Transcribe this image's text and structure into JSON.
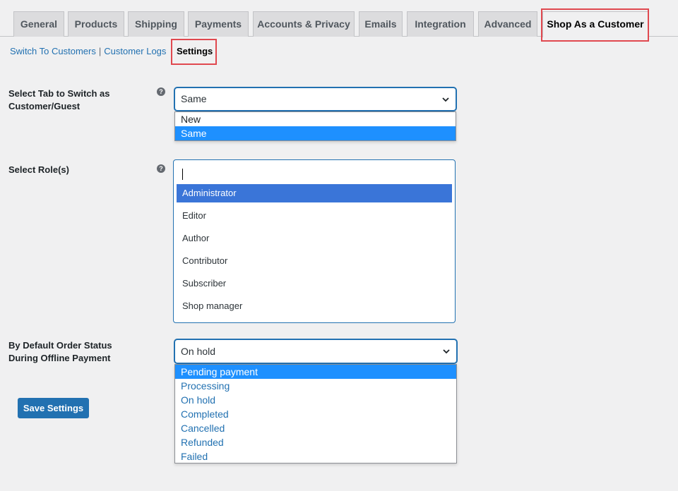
{
  "tabs": [
    {
      "label": "General"
    },
    {
      "label": "Products"
    },
    {
      "label": "Shipping"
    },
    {
      "label": "Payments"
    },
    {
      "label": "Accounts & Privacy"
    },
    {
      "label": "Emails"
    },
    {
      "label": "Integration"
    },
    {
      "label": "Advanced"
    },
    {
      "label": "Shop As a Customer"
    }
  ],
  "active_tab": "Shop As a Customer",
  "subnav": {
    "switch_to_customers": "Switch To Customers",
    "separator": "|",
    "customer_logs": "Customer Logs",
    "settings": "Settings"
  },
  "fields": {
    "switch_tab": {
      "label_line1": "Select Tab to Switch as",
      "label_line2": "Customer/Guest",
      "value": "Same",
      "options": [
        "New",
        "Same"
      ],
      "selected_option": "Same"
    },
    "roles": {
      "label": "Select Role(s)",
      "search_value": "",
      "options": [
        "Administrator",
        "Editor",
        "Author",
        "Contributor",
        "Subscriber",
        "Shop manager"
      ],
      "highlighted_option": "Administrator"
    },
    "order_status": {
      "label_line1": "By Default Order Status",
      "label_line2": "During Offline Payment",
      "value": "On hold",
      "options": [
        "Pending payment",
        "Processing",
        "On hold",
        "Completed",
        "Cancelled",
        "Refunded",
        "Failed"
      ],
      "highlighted_option": "Pending payment"
    }
  },
  "save_button": "Save Settings",
  "help_icon_glyph": "?",
  "colors": {
    "accent": "#2271b1",
    "highlight_border": "#e0484f",
    "option_selected": "#1e90ff",
    "role_highlight": "#3a75d8"
  }
}
